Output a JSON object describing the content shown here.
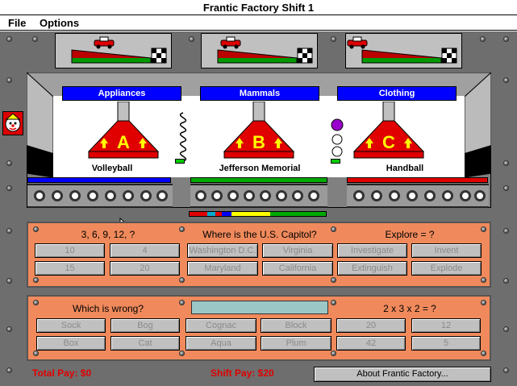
{
  "window": {
    "title": "Frantic Factory Shift 1"
  },
  "menu": {
    "file": "File",
    "options": "Options"
  },
  "hoppers": [
    {
      "category": "Appliances",
      "letter": "A",
      "item": "Volleyball",
      "conveyor_color": "#0000ff"
    },
    {
      "category": "Mammals",
      "letter": "B",
      "item": "Jefferson Memorial",
      "conveyor_color": "#00aa00"
    },
    {
      "category": "Clothing",
      "letter": "C",
      "item": "Handball",
      "conveyor_color": "#e00000"
    }
  ],
  "questions_top": [
    {
      "prompt": "3, 6, 9, 12, ?",
      "answers": [
        "10",
        "4",
        "15",
        "20"
      ]
    },
    {
      "prompt": "Where is the U.S. Capitol?",
      "answers": [
        "Washington D.C.",
        "Virginia",
        "Maryland",
        "California"
      ]
    },
    {
      "prompt": "Explore = ?",
      "answers": [
        "Investigate",
        "Invent",
        "Extinguish",
        "Explode"
      ]
    }
  ],
  "questions_bottom": [
    {
      "prompt": "Which is wrong?",
      "answers": [
        "Sock",
        "Bog",
        "Box",
        "Cat"
      ]
    },
    {
      "prompt": "",
      "answers": [
        "Cognac",
        "Block",
        "Aqua",
        "Plum"
      ]
    },
    {
      "prompt": "2 x 3 x 2 = ?",
      "answers": [
        "20",
        "12",
        "42",
        "5"
      ]
    }
  ],
  "footer": {
    "total_pay": "Total Pay: $0",
    "shift_pay": "Shift Pay: $20",
    "about_button": "About Frantic Factory..."
  },
  "colors": {
    "panel": "#f08a5c",
    "hopper_red": "#e00000",
    "hopper_yellow": "#ffff00",
    "label_blue": "#0000ff"
  },
  "icons": {
    "player": "clown-face-icon",
    "car": "race-car-icon",
    "flag": "checkered-flag-icon"
  }
}
